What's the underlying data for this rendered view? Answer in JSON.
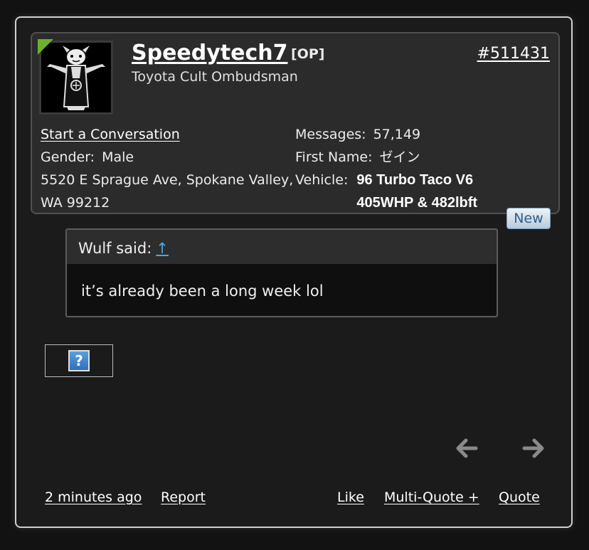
{
  "post": {
    "username": "Speedytech7",
    "op_tag": "[OP]",
    "user_title": "Toyota Cult Ombudsman",
    "post_number": "#511431",
    "start_conversation": "Start a Conversation",
    "gender_label": "Gender:",
    "gender_value": "Male",
    "address_line1": "5520 E Sprague Ave, Spokane Valley,",
    "address_line2": "WA 99212",
    "messages_label": "Messages:",
    "messages_value": "57,149",
    "first_name_label": "First Name:",
    "first_name_value": "ゼイン",
    "vehicle_label": "Vehicle:",
    "vehicle_value": "96 Turbo Taco V6 405WHP & 482lbft",
    "new_badge": "New",
    "status_color": "#6bb12a"
  },
  "quote": {
    "author_said": "Wulf said:",
    "jump_arrow": "↑",
    "text": "it’s already been a long week lol"
  },
  "image_placeholder": {
    "glyph": "?",
    "icon": "broken-image-icon"
  },
  "footer": {
    "time": "2 minutes ago",
    "report": "Report",
    "like": "Like",
    "multi_quote": "Multi-Quote +",
    "quote": "Quote"
  },
  "icons": {
    "prev": "arrow-left-icon",
    "next": "arrow-right-icon"
  }
}
